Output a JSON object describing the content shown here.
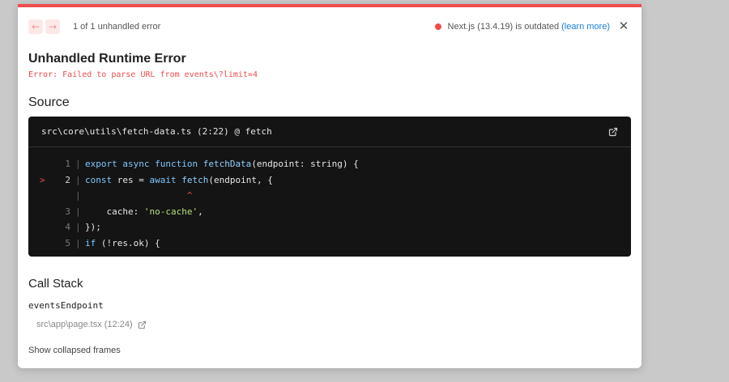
{
  "header": {
    "prev_arrow": "←",
    "next_arrow": "→",
    "error_count": "1 of 1 unhandled error",
    "version_text": "Next.js (13.4.19) is outdated",
    "learn_more": "(learn more)",
    "close_glyph": "✕"
  },
  "error": {
    "title": "Unhandled Runtime Error",
    "message": "Error: Failed to parse URL from events\\?limit=4"
  },
  "source": {
    "section_title": "Source",
    "file": "src\\core\\utils\\fetch-data.ts (2:22) @ fetch",
    "lines": [
      {
        "num": "1",
        "marker": "",
        "code": "export async function fetchData(endpoint: string) {"
      },
      {
        "num": "2",
        "marker": ">",
        "code": "const res = await fetch(endpoint, {"
      },
      {
        "num": "",
        "marker": "",
        "code": "                   ^"
      },
      {
        "num": "3",
        "marker": "",
        "code": "    cache: 'no-cache',"
      },
      {
        "num": "4",
        "marker": "",
        "code": "});"
      },
      {
        "num": "5",
        "marker": "",
        "code": "if (!res.ok) {"
      }
    ]
  },
  "call_stack": {
    "section_title": "Call Stack",
    "frame_name": "eventsEndpoint",
    "frame_location": "src\\app\\page.tsx (12:24)",
    "collapsed_label": "Show collapsed frames"
  },
  "colors": {
    "accent": "#ee4d4d",
    "link": "#1a7fd6",
    "code_bg": "#141414"
  }
}
